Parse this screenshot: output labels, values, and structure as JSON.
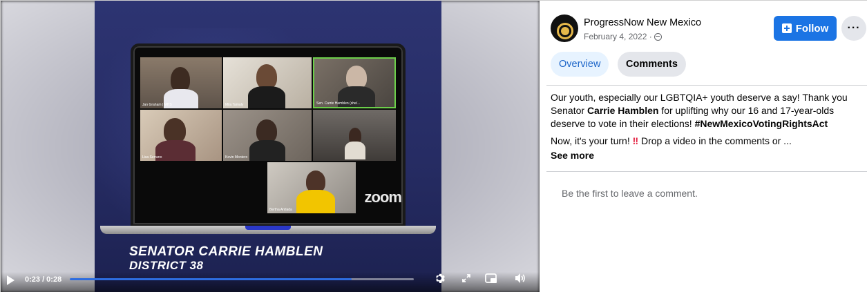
{
  "video": {
    "caption_line1": "SENATOR CARRIE HAMBLEN",
    "caption_line2": "DISTRICT 38",
    "zoom_watermark": "zoom",
    "time_display": "0:23 / 0:28",
    "progress_fraction": 0.82,
    "participants": [
      "Jan Graham | MHS",
      "Mila Tamaly",
      "Sen. Carrie Hamblen (she/...",
      "Lisa Serrano",
      "Kevin Montero",
      "",
      "Bertha Antlada"
    ],
    "controls": {
      "play_icon": "play-icon",
      "settings_icon": "gear-icon",
      "expand_icon": "expand-icon",
      "pip_icon": "picture-in-picture-icon",
      "volume_icon": "volume-icon"
    }
  },
  "post": {
    "page_name": "ProgressNow New Mexico",
    "date": "February 4, 2022 · ",
    "privacy_icon": "globe-icon",
    "follow_label": "Follow",
    "more_label": "···",
    "tabs": [
      {
        "label": "Overview",
        "active": true
      },
      {
        "label": "Comments",
        "active": false
      }
    ],
    "text": {
      "part1": "Our youth, especially our LGBTQIA+ youth deserve a say! Thank you Senator ",
      "bold_name": "Carrie Hamblen",
      "part2": " for uplifting why our 16 and 17-year-olds deserve to vote in their elections! ",
      "hashtag": "#NewMexicoVotingRightsAct",
      "line2_a": "Now, it's your turn! ",
      "bang": "‼",
      "line2_b": " Drop a video in the comments or ...",
      "see_more": "See more"
    },
    "empty_comments": "Be the first to leave a comment."
  },
  "colors": {
    "accent": "#1b74e4",
    "overview_tab_bg": "#e7f3ff",
    "progress_fill": "#2d6cdf"
  }
}
